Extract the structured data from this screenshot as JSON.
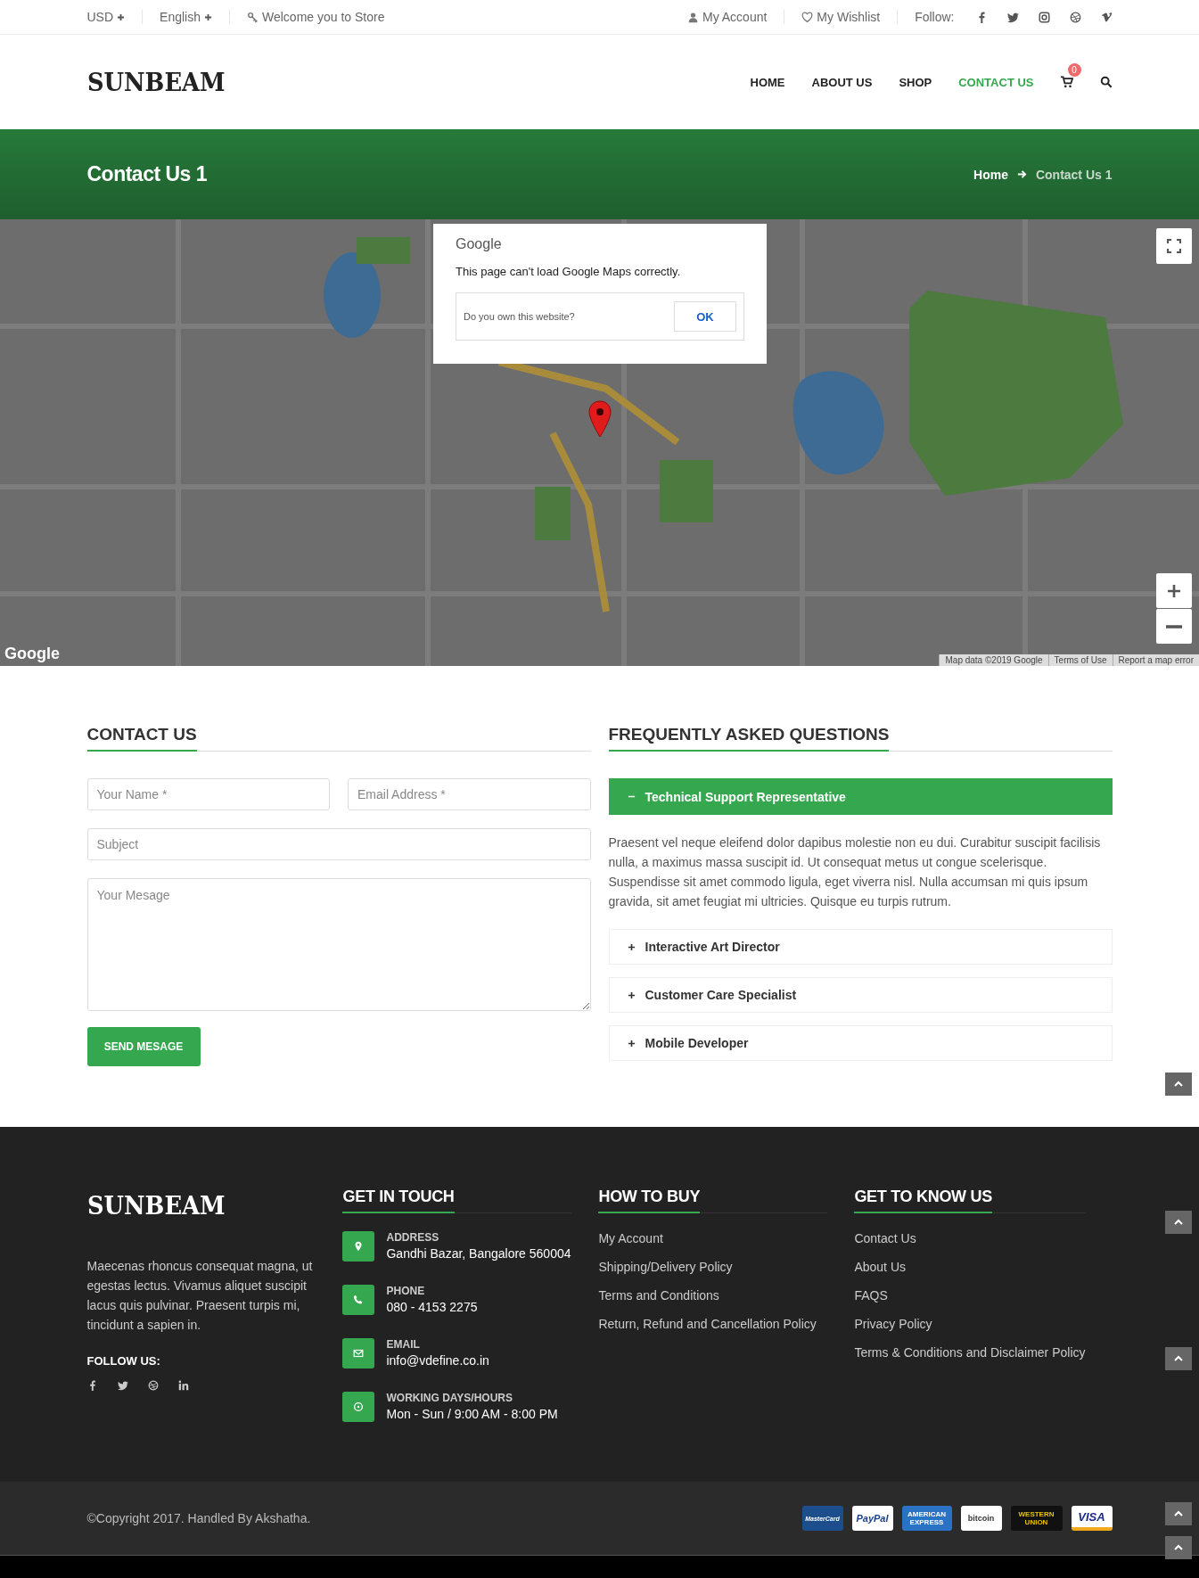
{
  "top_bar": {
    "currency": "USD",
    "language": "English",
    "welcome": "Welcome you to Store",
    "account": "My Account",
    "wishlist": "My Wishlist",
    "follow_label": "Follow:",
    "social": [
      {
        "kind": "facebook"
      },
      {
        "kind": "twitter"
      },
      {
        "kind": "instagram"
      },
      {
        "kind": "dribbble"
      },
      {
        "kind": "vimeo"
      }
    ]
  },
  "header": {
    "logo": "SUNBEAM",
    "nav": [
      {
        "label": "HOME",
        "selected": false
      },
      {
        "label": "ABOUT US",
        "selected": false
      },
      {
        "label": "SHOP",
        "selected": false
      },
      {
        "label": "CONTACT US",
        "selected": true
      }
    ],
    "cart_count": "0"
  },
  "banner": {
    "title": "Contact Us 1",
    "breadcrumb": [
      "Home",
      "Contact Us 1"
    ]
  },
  "map": {
    "dialog": {
      "brand": "Google",
      "message": "This page can't load Google Maps correctly.",
      "question": "Do you own this website?",
      "button": "OK"
    },
    "logo": "Google",
    "attribution": [
      "Map data ©2019 Google",
      "Terms of Use",
      "Report a map error"
    ]
  },
  "contact": {
    "heading": "CONTACT US",
    "fields": [
      {
        "kind": "input",
        "placeholder": "Your Name *"
      },
      {
        "kind": "input",
        "placeholder": "Email Address *"
      },
      {
        "kind": "input",
        "placeholder": "Subject"
      },
      {
        "kind": "textarea",
        "placeholder": "Your Mesage"
      }
    ],
    "button": "SEND MESAGE"
  },
  "faq": {
    "heading": "FREQUENTLY ASKED QUESTIONS",
    "items": [
      {
        "title": "Technical Support Representative",
        "expanded": true,
        "body": "Praesent vel neque eleifend dolor dapibus molestie non eu dui. Curabitur suscipit facilisis nulla, a maximus massa suscipit id. Ut consequat metus ut congue scelerisque. Suspendisse sit amet commodo ligula, eget viverra nisl. Nulla accumsan mi quis ipsum gravida, sit amet feugiat mi ultricies. Quisque eu turpis rutrum."
      },
      {
        "title": "Interactive Art Director",
        "expanded": false
      },
      {
        "title": "Customer Care Specialist",
        "expanded": false
      },
      {
        "title": "Mobile Developer",
        "expanded": false
      }
    ]
  },
  "footer": {
    "logo": "SUNBEAM",
    "about": "Maecenas rhoncus consequat magna, ut egestas lectus. Vivamus aliquet suscipit lacus quis pulvinar. Praesent turpis mi, tincidunt a sapien in.",
    "follow_label": "FOLLOW US:",
    "social": [
      {
        "kind": "facebook"
      },
      {
        "kind": "twitter"
      },
      {
        "kind": "dribbble"
      },
      {
        "kind": "linkedin"
      }
    ],
    "get_in_touch": {
      "heading": "GET IN TOUCH",
      "items": [
        {
          "kind": "address",
          "label": "ADDRESS",
          "value": "Gandhi Bazar, Bangalore 560004"
        },
        {
          "kind": "phone",
          "label": "PHONE",
          "value": "080 - 4153 2275"
        },
        {
          "kind": "email",
          "label": "EMAIL",
          "value": "info@vdefine.co.in"
        },
        {
          "kind": "hours",
          "label": "WORKING DAYS/HOURS",
          "value": "Mon - Sun / 9:00 AM - 8:00 PM"
        }
      ]
    },
    "how_to_buy": {
      "heading": "HOW TO BUY",
      "links": [
        "My Account",
        "Shipping/Delivery Policy",
        "Terms and Conditions",
        "Return, Refund and Cancellation Policy"
      ]
    },
    "know_us": {
      "heading": "GET TO KNOW US",
      "links": [
        "Contact Us",
        "About Us",
        "FAQS",
        "Privacy Policy",
        "Terms & Conditions and Disclaimer Policy"
      ]
    }
  },
  "bottom_bar": {
    "copyright": "©Copyright 2017. Handled By Akshatha.",
    "payments": [
      {
        "kind": "mastercard",
        "label": "MasterCard"
      },
      {
        "kind": "paypal",
        "label": "PayPal"
      },
      {
        "kind": "amex",
        "label": "AMERICAN EXPRESS"
      },
      {
        "kind": "bitcoin",
        "label": "bitcoin"
      },
      {
        "kind": "westernunion",
        "label": "WESTERN UNION"
      },
      {
        "kind": "visa",
        "label": "VISA"
      }
    ]
  }
}
